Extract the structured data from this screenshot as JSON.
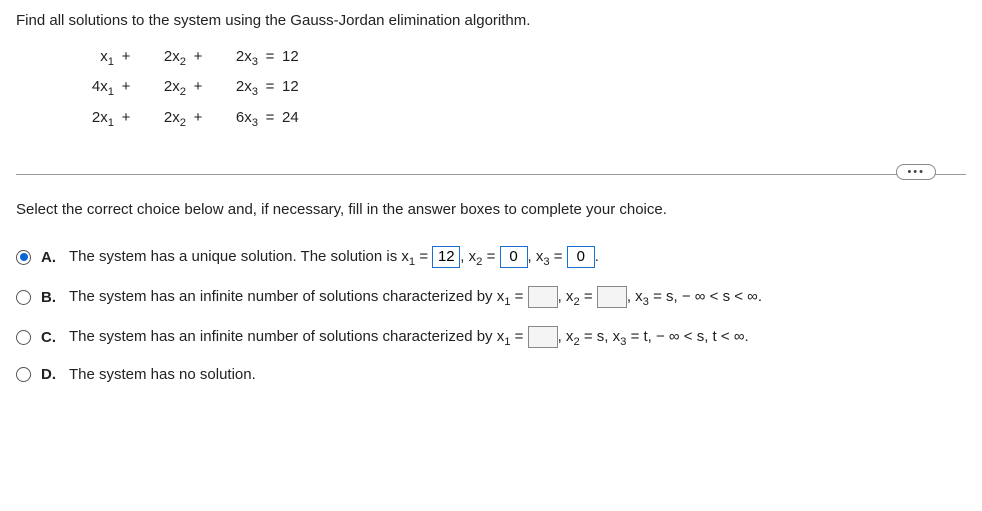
{
  "prompt": "Find all solutions to the system using the Gauss-Jordan elimination algorithm.",
  "equations": {
    "rows": [
      {
        "c1": "x",
        "s1": "1",
        "p1": "+",
        "c2": "2x",
        "s2": "2",
        "p2": "+",
        "c3": "2x",
        "s3": "3",
        "eq": "=",
        "r": "12"
      },
      {
        "c1": "4x",
        "s1": "1",
        "p1": "+",
        "c2": "2x",
        "s2": "2",
        "p2": "+",
        "c3": "2x",
        "s3": "3",
        "eq": "=",
        "r": "12"
      },
      {
        "c1": "2x",
        "s1": "1",
        "p1": "+",
        "c2": "2x",
        "s2": "2",
        "p2": "+",
        "c3": "6x",
        "s3": "3",
        "eq": "=",
        "r": "24"
      }
    ]
  },
  "ellipsis": "•••",
  "instruction": "Select the correct choice below and, if necessary, fill in the answer boxes to complete your choice.",
  "choices": {
    "a": {
      "label": "A.",
      "pre": "The system has a unique solution. The solution is x",
      "s1": "1",
      "eq1": " = ",
      "v1": "12",
      "mid1": ", x",
      "s2": "2",
      "eq2": " = ",
      "v2": "0",
      "mid2": ", x",
      "s3": "3",
      "eq3": " = ",
      "v3": "0",
      "end": "."
    },
    "b": {
      "label": "B.",
      "pre": "The system has an infinite number of solutions characterized by x",
      "s1": "1",
      "eq1": " = ",
      "mid1": ", x",
      "s2": "2",
      "eq2": " = ",
      "mid2": ", x",
      "s3": "3",
      "tail": " = s,  − ∞ < s < ∞."
    },
    "c": {
      "label": "C.",
      "pre": "The system has an infinite number of solutions characterized by x",
      "s1": "1",
      "eq1": " = ",
      "mid1": ", x",
      "s2": "2",
      "tail": " = s, x",
      "s3": "3",
      "tail2": " = t,  − ∞ < s, t < ∞."
    },
    "d": {
      "label": "D.",
      "text": "The system has no solution."
    }
  }
}
